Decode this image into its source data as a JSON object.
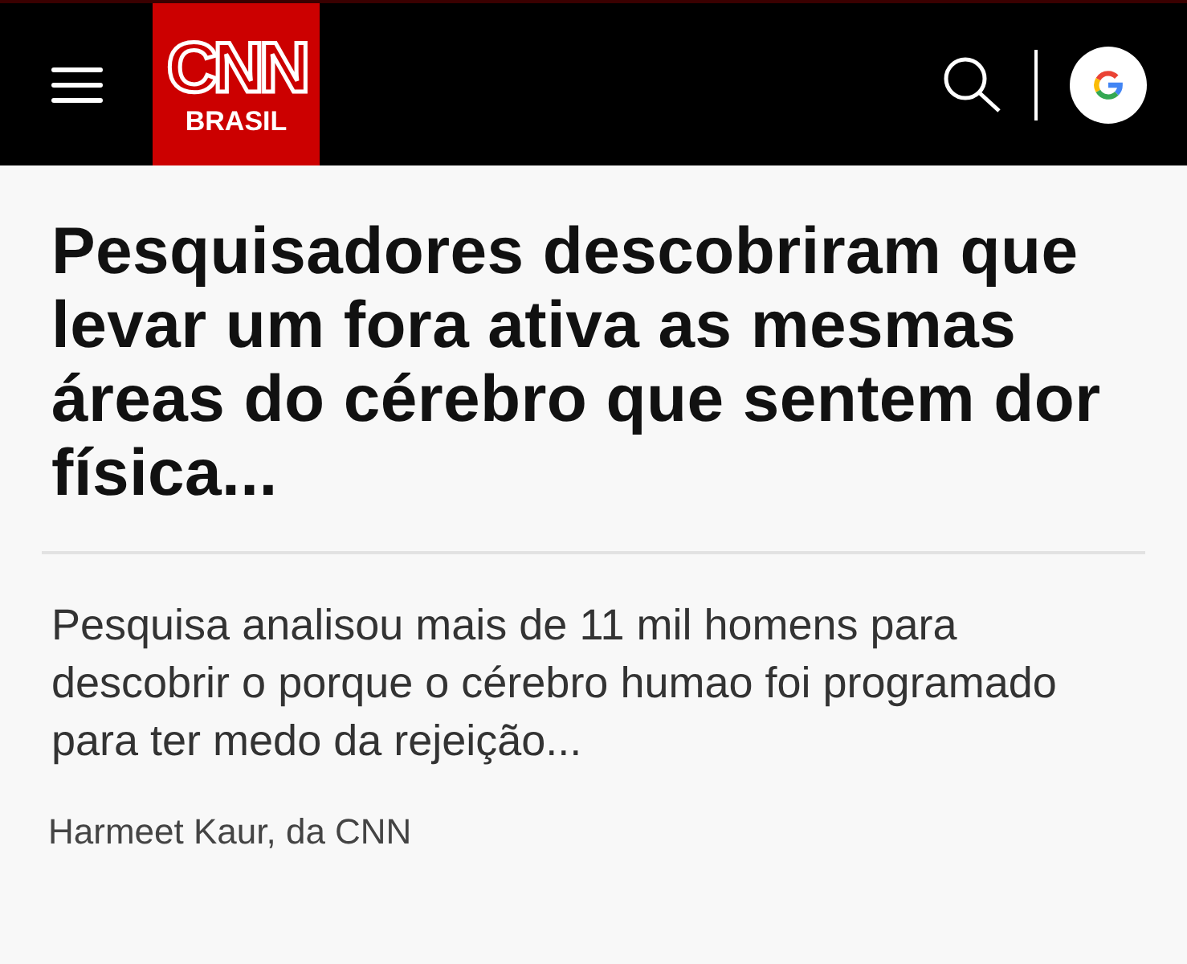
{
  "header": {
    "logo": {
      "brand": "CNN",
      "edition": "BRASIL"
    }
  },
  "article": {
    "headline": "Pesquisadores descobriram que levar um fora ativa as mesmas áreas do cérebro que sentem dor física...",
    "summary": "Pesquisa analisou mais de 11 mil homens para descobrir o porque o cérebro humao foi programado para ter medo da rejeição...",
    "byline": "Harmeet Kaur, da CNN"
  }
}
